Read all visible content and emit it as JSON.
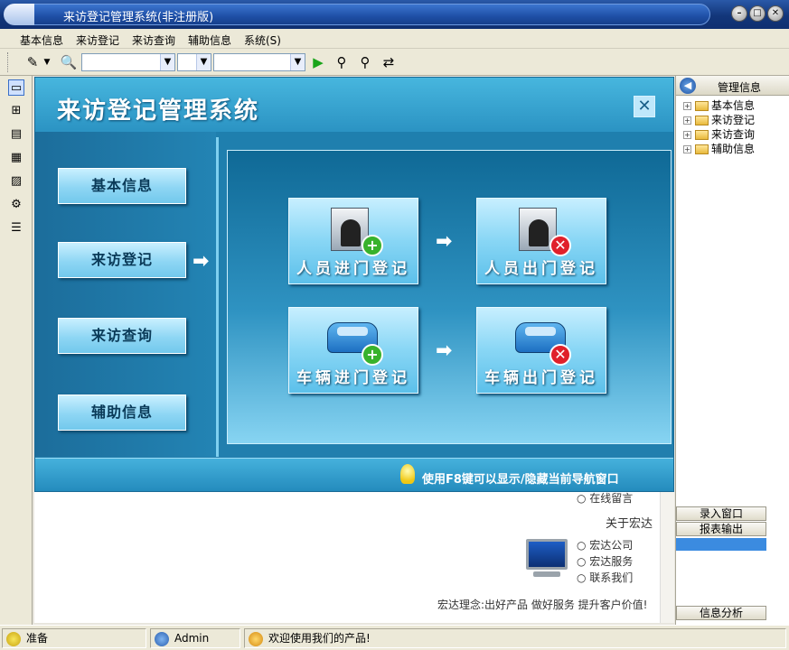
{
  "window": {
    "title": "来访登记管理系统(非注册版)",
    "minimize": "–",
    "restore": "□",
    "close": "✕"
  },
  "menu": {
    "items": [
      "基本信息",
      "来访登记",
      "来访查询",
      "辅助信息",
      "系统(S)"
    ]
  },
  "toolbar": {
    "combo1": "",
    "combo2": "",
    "combo3": "",
    "icons": [
      "pencil-icon",
      "search-icon",
      "run-icon",
      "user-search-icon",
      "user-find-icon",
      "refresh-icon"
    ]
  },
  "leftbar": {
    "icons": [
      "window-icon",
      "tree-structure-icon",
      "table-icon",
      "document-icon",
      "chart-icon",
      "settings-icon",
      "list-icon"
    ]
  },
  "splash": {
    "title": "来访登记管理系统",
    "close": "✕",
    "nav": [
      "基本信息",
      "来访登记",
      "来访查询",
      "辅助信息"
    ],
    "tiles": [
      {
        "label": "人员进门登记",
        "badge": "+"
      },
      {
        "label": "人员出门登记",
        "badge": "✕"
      },
      {
        "label": "车辆进门登记",
        "badge": "+"
      },
      {
        "label": "车辆出门登记",
        "badge": "✕"
      }
    ],
    "flow_arrow": "➡",
    "hint": "使用F8键可以显示/隐藏当前导航窗口"
  },
  "lower": {
    "top_link": "○ 在线留言",
    "heading": "关于宏达",
    "links": [
      "○ 宏达公司",
      "○ 宏达服务",
      "○ 联系我们"
    ],
    "slogan": "宏达理念:出好产品 做好服务 提升客户价值!"
  },
  "right_panel": {
    "title": "管理信息",
    "tree": [
      "基本信息",
      "来访登记",
      "来访查询",
      "辅助信息"
    ],
    "buttons": [
      "录入窗口",
      "报表输出",
      "信息分析"
    ]
  },
  "status": {
    "state": "准备",
    "user": "Admin",
    "message": "欢迎使用我们的产品!"
  },
  "colors": {
    "accent": "#2f98c3",
    "titlebar": "#12367a",
    "add": "#38b22c",
    "remove": "#e0202a"
  }
}
